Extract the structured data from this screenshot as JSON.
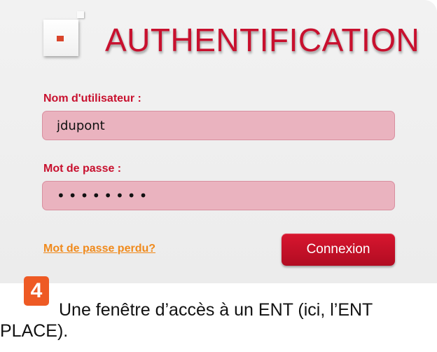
{
  "auth": {
    "title": "AUTHENTIFICATION",
    "username_label": "Nom d'utilisateur :",
    "username_value": "jdupont",
    "password_label": "Mot de passe :",
    "password_value": "••••••••",
    "forgot_link": "Mot de passe perdu?",
    "connect_button": "Connexion"
  },
  "caption": {
    "step_number": "4",
    "line1": "Une fenêtre d’accès à un ENT (ici, l’ENT",
    "line2": "PLACE)."
  },
  "colors": {
    "accent_red": "#c8102e",
    "input_pink": "#eab3bf",
    "link_orange": "#f08a1c",
    "badge_orange": "#ee5a24"
  }
}
